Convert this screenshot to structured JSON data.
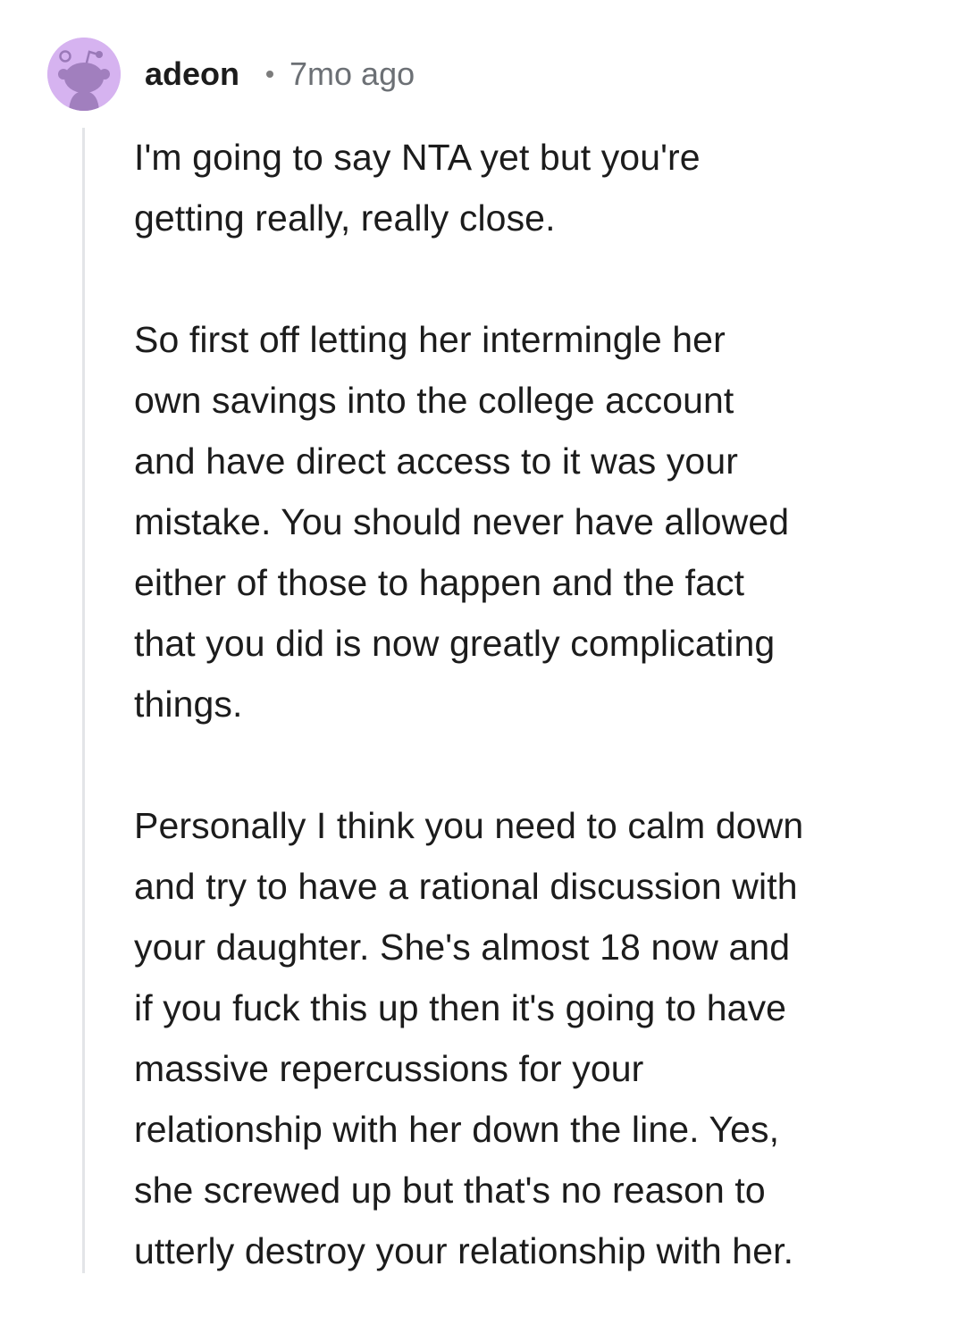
{
  "comment": {
    "author": "adeon",
    "age": "7mo ago",
    "avatar_icon": "reddit-snoo-avatar-icon",
    "avatar_color": "#d6b3f0",
    "paragraphs": [
      {
        "lines": [
          "I'm going to say NTA yet but you're",
          "getting really, really close."
        ]
      },
      {
        "lines": [
          "So first off letting her intermingle her",
          "own savings into the college account",
          "and have direct access to it was your",
          "mistake. You should never have allowed",
          "either of those to happen and the fact",
          "that you did is now greatly complicating",
          "things."
        ]
      },
      {
        "lines": [
          "Personally I think you need to calm down",
          "and try to have a rational discussion with",
          "your daughter. She's almost 18 now and",
          "if you fuck this up then it's going to have",
          "massive repercussions for your",
          "relationship with her down the line. Yes,",
          "she screwed up but that's no reason to",
          "utterly destroy your relationship with her."
        ]
      }
    ]
  }
}
